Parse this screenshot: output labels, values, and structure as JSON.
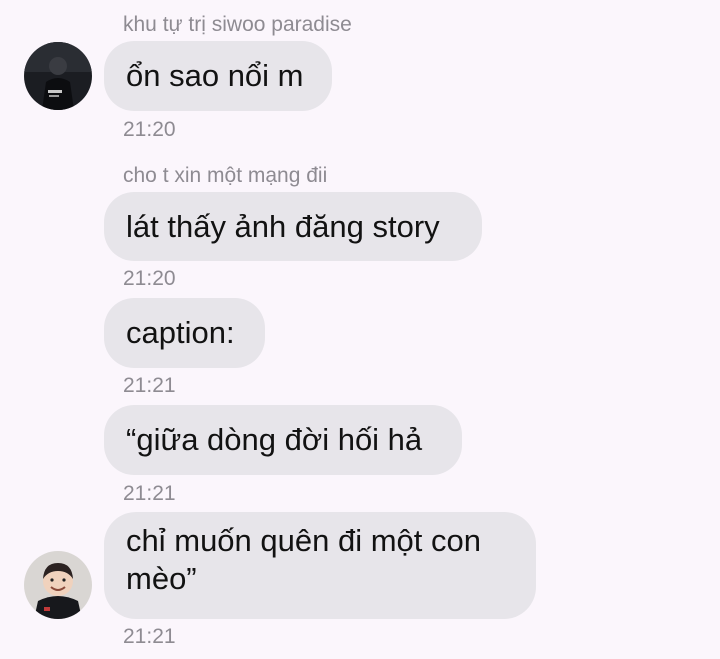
{
  "messages": [
    {
      "sender": "khu tự trị siwoo paradise",
      "text": "ổn sao nổi m",
      "time": "21:20",
      "avatar": "user-photo-dark"
    },
    {
      "sender": "cho t xin một mạng đii",
      "text": "lát thấy ảnh đăng story",
      "time": "21:20"
    },
    {
      "text": "caption:",
      "time": "21:21"
    },
    {
      "text": "“giữa dòng đời hối hả",
      "time": "21:21"
    },
    {
      "text": "chỉ muốn quên đi một con mèo”",
      "time": "21:21",
      "avatar": "user-photo-smiling"
    }
  ],
  "colors": {
    "background": "#fbf6fc",
    "bubble": "#e7e5ea",
    "meta_text": "#8e8b92"
  }
}
